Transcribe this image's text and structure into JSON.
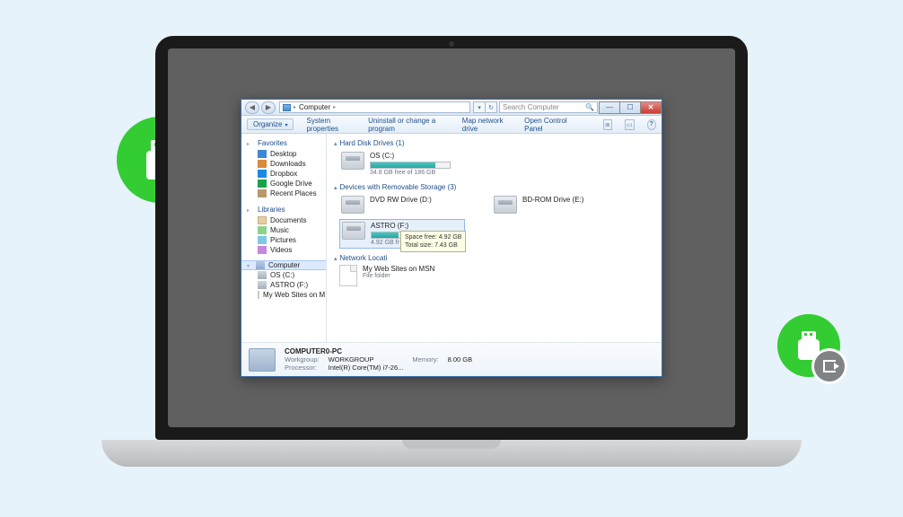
{
  "address": {
    "location": "Computer"
  },
  "search": {
    "placeholder": "Search Computer"
  },
  "toolbar": {
    "organize": "Organize",
    "items": [
      "System properties",
      "Uninstall or change a program",
      "Map network drive",
      "Open Control Panel"
    ]
  },
  "sidebar": {
    "favorites": {
      "title": "Favorites",
      "items": [
        "Desktop",
        "Downloads",
        "Dropbox",
        "Google Drive",
        "Recent Places"
      ]
    },
    "libraries": {
      "title": "Libraries",
      "items": [
        "Documents",
        "Music",
        "Pictures",
        "Videos"
      ]
    },
    "computer": {
      "title": "Computer",
      "items": [
        "OS (C:)",
        "ASTRO (F:)",
        "My Web Sites on M"
      ]
    }
  },
  "main": {
    "hdd": {
      "title": "Hard Disk Drives (1)",
      "drives": [
        {
          "name": "OS (C:)",
          "meta": "34.8 GB free of 186 GB",
          "fill_pct": 82
        }
      ]
    },
    "removable": {
      "title": "Devices with Removable Storage (3)",
      "drives": [
        {
          "name": "DVD RW Drive (D:)",
          "meta": ""
        },
        {
          "name": "BD-ROM Drive (E:)",
          "meta": ""
        },
        {
          "name": "ASTRO (F:)",
          "meta": "4.92 GB fr",
          "fill_pct": 34
        }
      ]
    },
    "tooltip": {
      "line1": "Space free: 4.92 GB",
      "line2": "Total size: 7.43 GB"
    },
    "network": {
      "title": "Network Locati",
      "items": [
        {
          "name": "My Web Sites on MSN",
          "type": "File folder"
        }
      ]
    }
  },
  "details": {
    "name": "COMPUTER0-PC",
    "workgroup_lbl": "Workgroup:",
    "workgroup": "WORKGROUP",
    "memory_lbl": "Memory:",
    "memory": "8.00 GB",
    "processor_lbl": "Processor:",
    "processor": "Intel(R) Core(TM) i7-26..."
  }
}
